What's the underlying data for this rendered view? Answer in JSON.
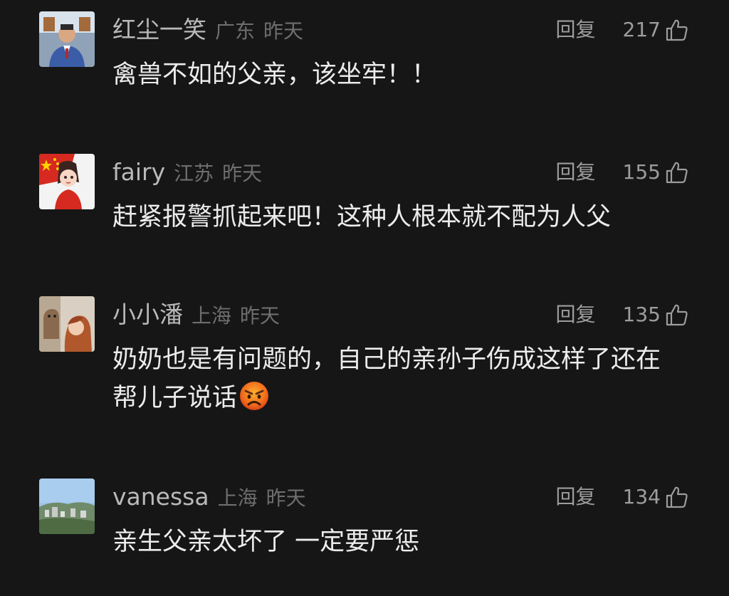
{
  "comments": [
    {
      "username": "红尘一笑",
      "location": "广东",
      "time": "昨天",
      "reply_label": "回复",
      "likes": "217",
      "text": "禽兽不如的父亲，该坐牢！！"
    },
    {
      "username": "fairy",
      "location": "江苏",
      "time": "昨天",
      "reply_label": "回复",
      "likes": "155",
      "text": "赶紧报警抓起来吧！这种人根本就不配为人父"
    },
    {
      "username": "小小潘",
      "location": "上海",
      "time": "昨天",
      "reply_label": "回复",
      "likes": "135",
      "text": "奶奶也是有问题的，自己的亲孙子伤成这样了还在帮儿子说话",
      "emoji": "angry-face-icon"
    },
    {
      "username": "vanessa",
      "location": "上海",
      "time": "昨天",
      "reply_label": "回复",
      "likes": "134",
      "text": "亲生父亲太坏了 一定要严惩"
    }
  ],
  "colors": {
    "background": "#161616",
    "username": "#b9b9b9",
    "meta": "#6e6e6e",
    "text": "#ececec",
    "action": "#9d9d9d"
  }
}
